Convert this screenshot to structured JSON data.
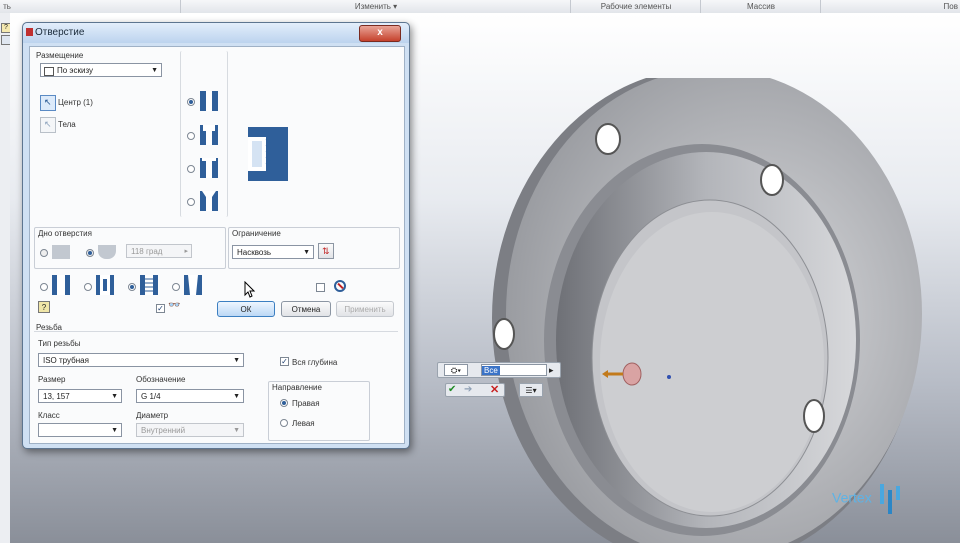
{
  "ribbon": {
    "left_cut": "ть",
    "modify": "Изменить ▾",
    "work_features": "Рабочие элементы",
    "pattern": "Массив",
    "right_cut": "Пов"
  },
  "dialog": {
    "title": "Отверстие",
    "close": "x",
    "placement": {
      "label": "Размещение",
      "method": "По эскизу",
      "center": "Центр (1)",
      "bodies": "Тела"
    },
    "drill_point": {
      "label": "Дно отверстия",
      "angle": "118 град"
    },
    "termination": {
      "label": "Ограничение",
      "value": "Насквозь"
    },
    "buttons": {
      "ok": "ОК",
      "cancel": "Отмена",
      "apply": "Применить",
      "help": "?"
    },
    "thread": {
      "label": "Резьба",
      "type_label": "Тип резьбы",
      "type_value": "ISO трубная",
      "full_depth": "Вся глубина",
      "size_label": "Размер",
      "size_value": "13, 157",
      "designation_label": "Обозначение",
      "designation_value": "G 1/4",
      "class_label": "Класс",
      "class_value": "",
      "diameter_label": "Диаметр",
      "diameter_value": "Внутренний",
      "direction_label": "Направление",
      "right": "Правая",
      "left": "Левая"
    }
  },
  "minitoolbar": {
    "field": "Все"
  },
  "brand": "Vertex"
}
